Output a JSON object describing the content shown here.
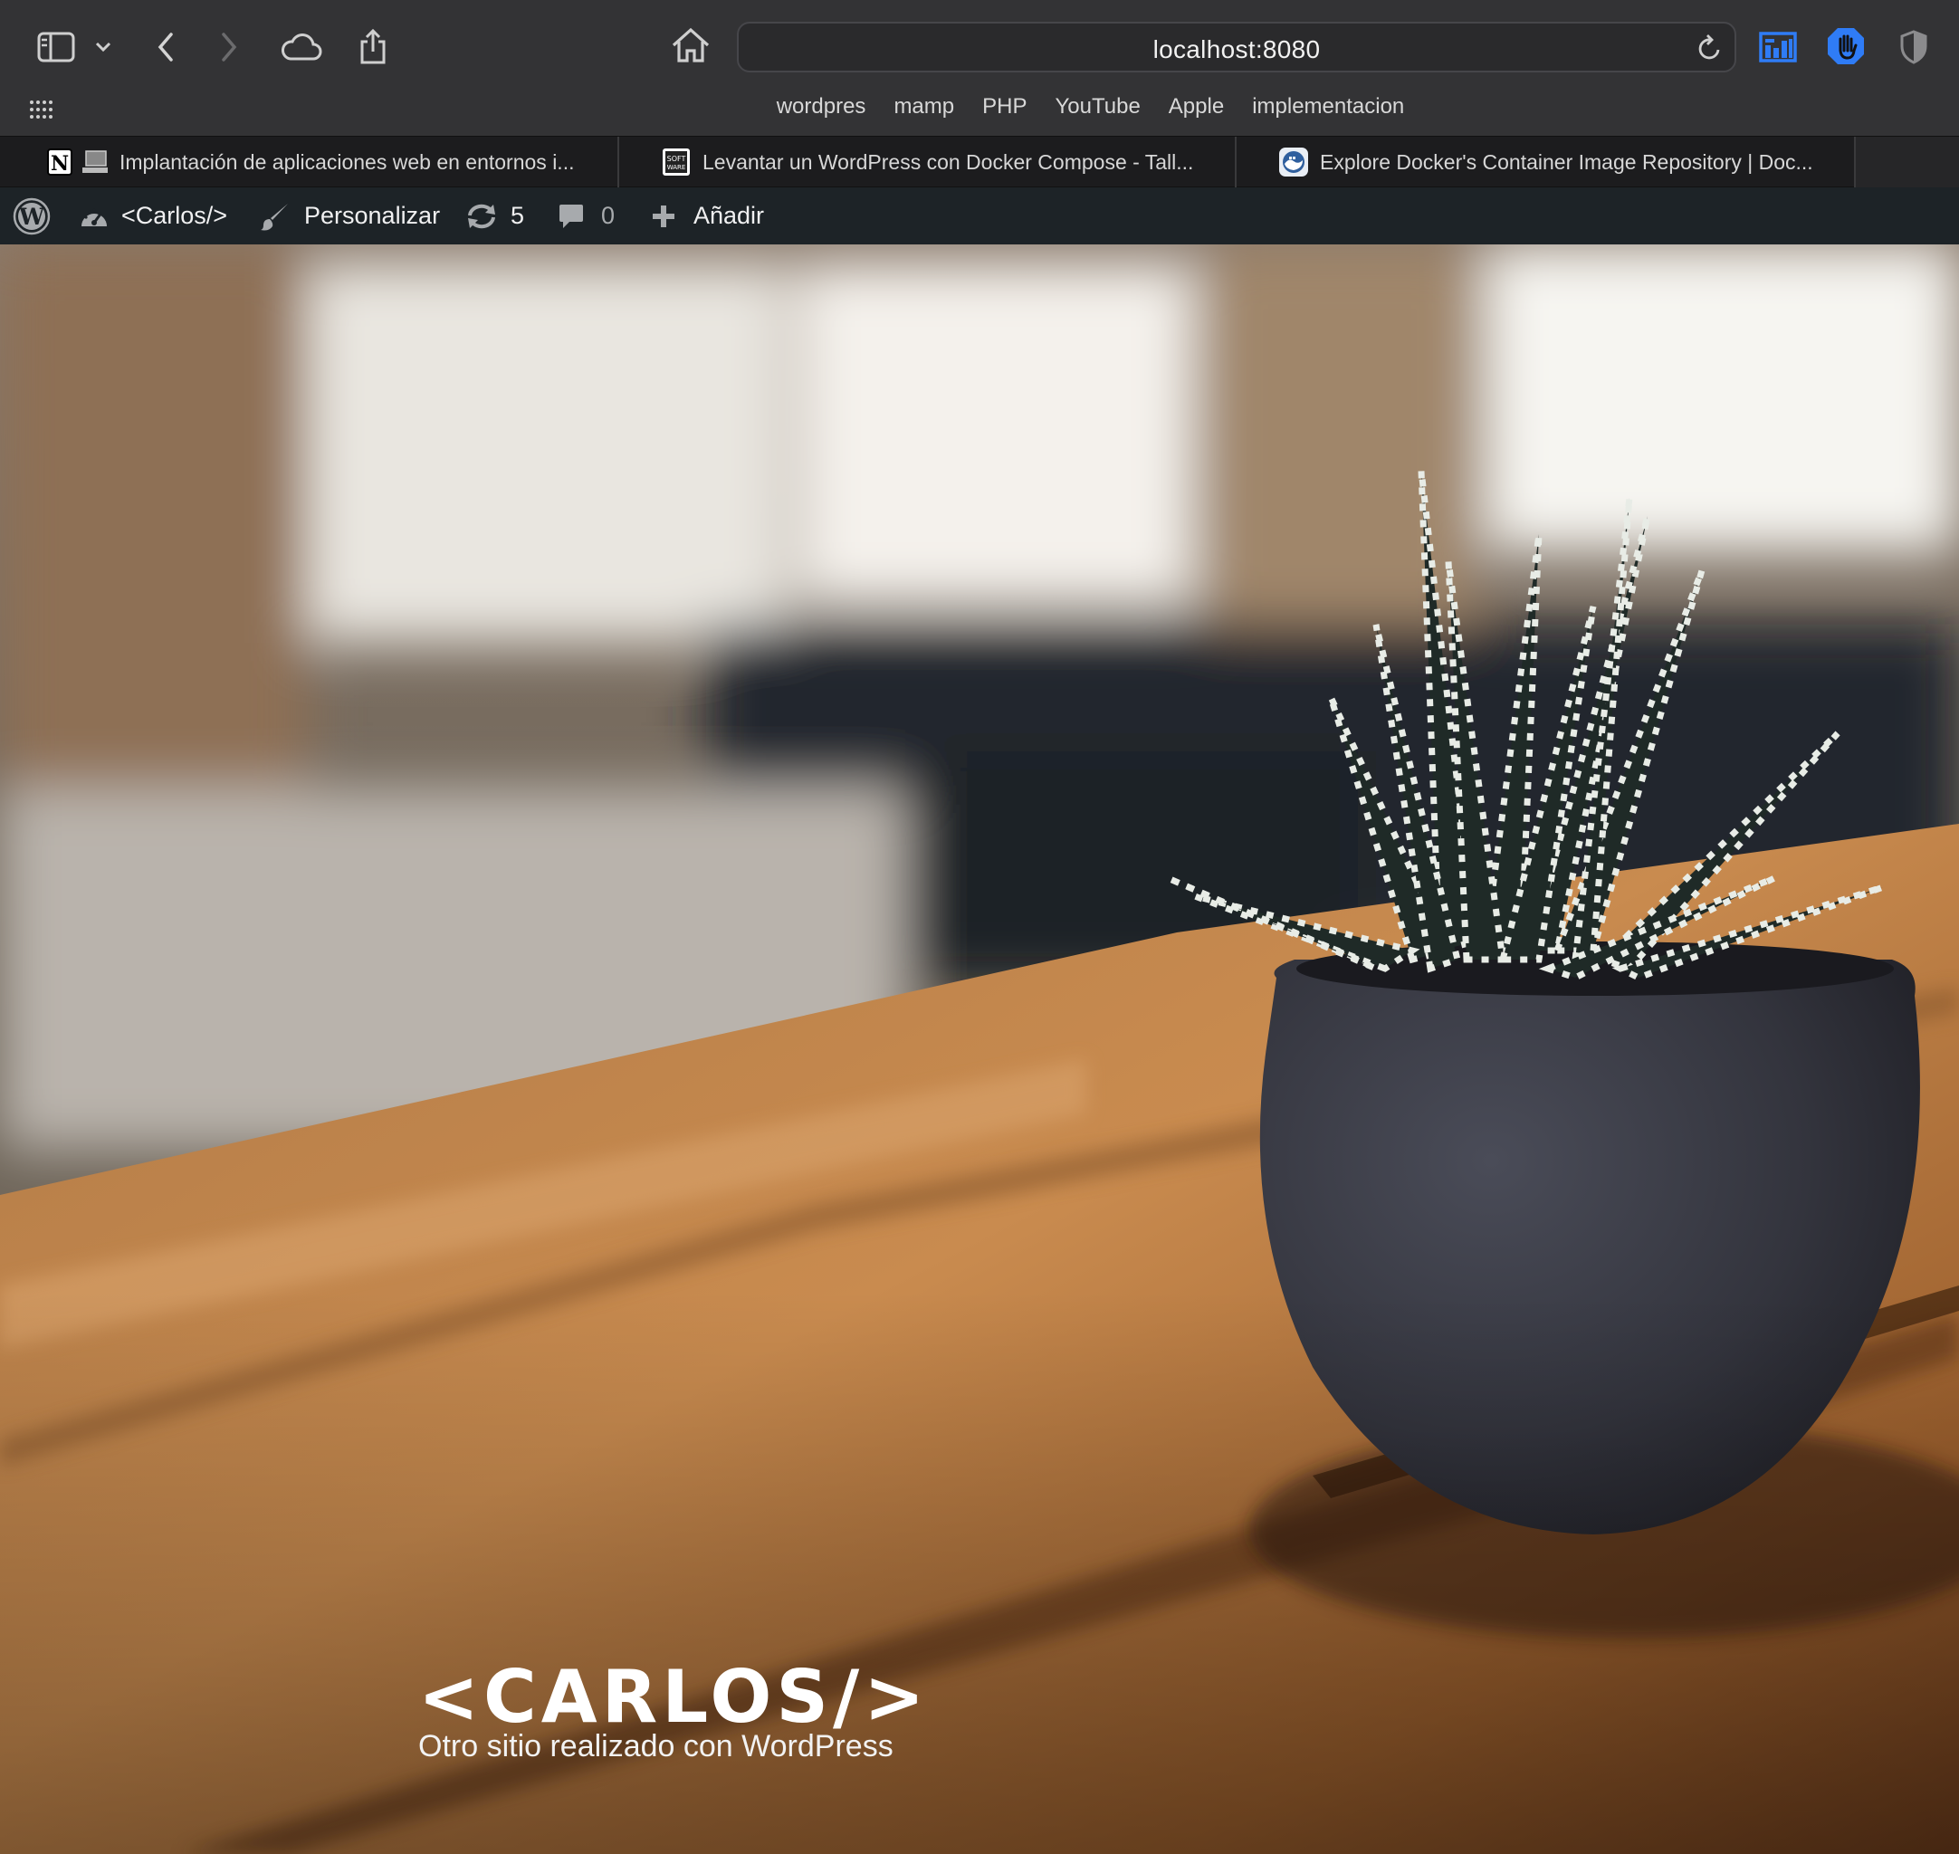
{
  "browser": {
    "address": "localhost:8080",
    "bookmarks": [
      "wordpres",
      "mamp",
      "PHP",
      "YouTube",
      "Apple",
      "implementacion"
    ],
    "tabs": [
      {
        "title": "Implantación de aplicaciones web en entornos i...",
        "icon": "notion-icon"
      },
      {
        "title": "Levantar un WordPress con Docker Compose - Tall...",
        "icon": "softwarecrafters-icon"
      },
      {
        "title": "Explore Docker's Container Image Repository | Doc...",
        "icon": "docker-icon"
      }
    ],
    "accent_color": "#2f7cf6"
  },
  "adminbar": {
    "site_name": "<Carlos/>",
    "customize": "Personalizar",
    "updates_count": "5",
    "comments_count": "0",
    "add_new": "Añadir"
  },
  "hero": {
    "title": "<CARLOS/>",
    "description": "Otro sitio realizado con WordPress"
  }
}
